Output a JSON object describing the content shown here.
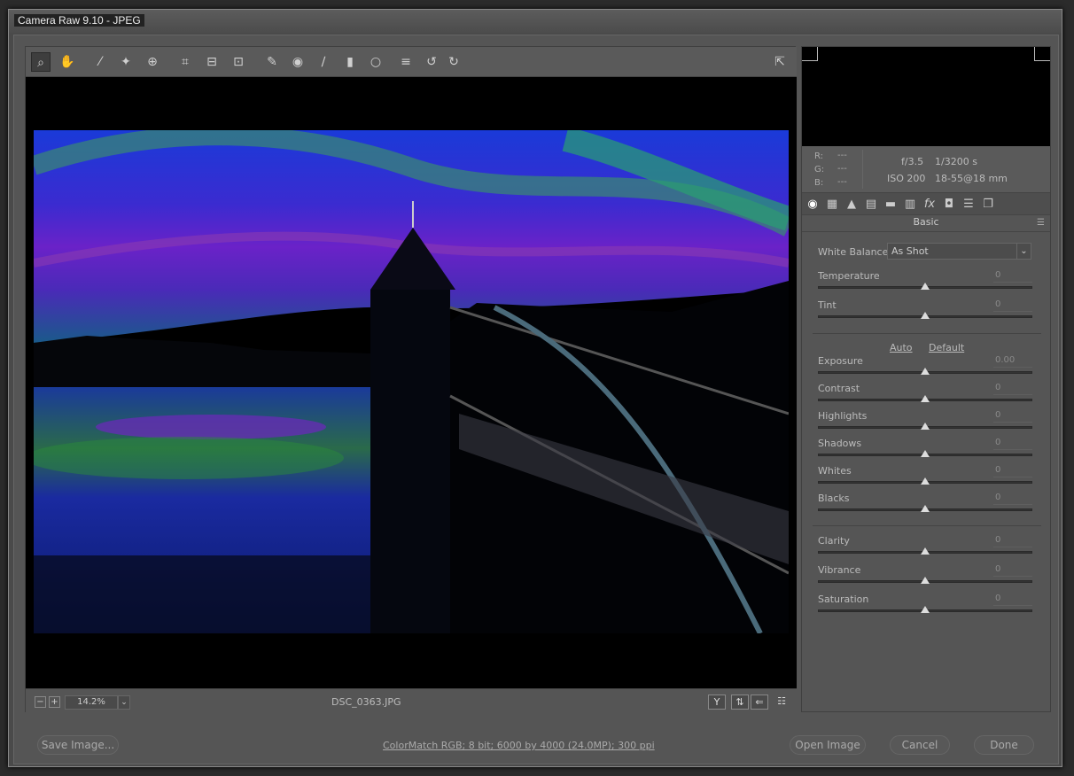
{
  "window": {
    "title": "Camera Raw 9.10  -  JPEG"
  },
  "toolbar": {
    "tools": [
      {
        "name": "zoom-tool",
        "icon": "magnifier-icon",
        "glyph": "⌕"
      },
      {
        "name": "hand-tool",
        "icon": "hand-icon",
        "glyph": "✋"
      },
      {
        "name": "white-balance-tool",
        "icon": "eyedropper-icon",
        "glyph": "⁄"
      },
      {
        "name": "color-sampler-tool",
        "icon": "color-sampler-icon",
        "glyph": "✦"
      },
      {
        "name": "targeted-adjustment-tool",
        "icon": "target-icon",
        "glyph": "⊕"
      },
      {
        "name": "crop-tool",
        "icon": "crop-icon",
        "glyph": "⌗"
      },
      {
        "name": "straighten-tool",
        "icon": "straighten-icon",
        "glyph": "⊟"
      },
      {
        "name": "transform-tool",
        "icon": "transform-icon",
        "glyph": "⊡"
      },
      {
        "name": "spot-removal-tool",
        "icon": "spot-removal-icon",
        "glyph": "✎"
      },
      {
        "name": "red-eye-tool",
        "icon": "red-eye-icon",
        "glyph": "◉"
      },
      {
        "name": "adjustment-brush-tool",
        "icon": "brush-icon",
        "glyph": "∕"
      },
      {
        "name": "graduated-filter-tool",
        "icon": "graduated-filter-icon",
        "glyph": "▮"
      },
      {
        "name": "radial-filter-tool",
        "icon": "radial-filter-icon",
        "glyph": "○"
      },
      {
        "name": "preferences-tool",
        "icon": "list-icon",
        "glyph": "≡"
      },
      {
        "name": "rotate-left-tool",
        "icon": "rotate-left-icon",
        "glyph": "↺"
      },
      {
        "name": "rotate-right-tool",
        "icon": "rotate-right-icon",
        "glyph": "↻"
      }
    ],
    "fullscreen_glyph": "⇱"
  },
  "status": {
    "zoom_out": "−",
    "zoom_in": "+",
    "zoom": "14.2%",
    "zoom_drop": "⌄",
    "filename": "DSC_0363.JPG",
    "view_y": "Y",
    "view_swap": "⇅",
    "view_arrow": "⇐",
    "view_settings": "☷"
  },
  "info": {
    "r_label": "R:",
    "g_label": "G:",
    "b_label": "B:",
    "r_val": "---",
    "g_val": "---",
    "b_val": "---",
    "aperture": "f/3.5",
    "shutter": "1/3200 s",
    "iso": "ISO 200",
    "lens": "18-55@18 mm"
  },
  "panel": {
    "tabs": [
      {
        "name": "tab-basic",
        "icon": "basic-icon",
        "glyph": "◉"
      },
      {
        "name": "tab-tone-curve",
        "icon": "tone-curve-icon",
        "glyph": "▦"
      },
      {
        "name": "tab-detail",
        "icon": "detail-icon",
        "glyph": "▲"
      },
      {
        "name": "tab-hsl",
        "icon": "hsl-icon",
        "glyph": "▤"
      },
      {
        "name": "tab-split-toning",
        "icon": "split-toning-icon",
        "glyph": "▬"
      },
      {
        "name": "tab-lens",
        "icon": "lens-icon",
        "glyph": "▥"
      },
      {
        "name": "tab-effects",
        "icon": "fx-icon",
        "glyph": "fx"
      },
      {
        "name": "tab-camera-calibration",
        "icon": "camera-icon",
        "glyph": "◘"
      },
      {
        "name": "tab-presets",
        "icon": "presets-icon",
        "glyph": "☰"
      },
      {
        "name": "tab-snapshots",
        "icon": "snapshots-icon",
        "glyph": "❐"
      }
    ],
    "title": "Basic",
    "menu_glyph": "☰",
    "wb_label": "White Balance:",
    "wb_value": "As Shot",
    "wb_arrow": "⌄",
    "auto": "Auto",
    "default": "Default",
    "sliders": {
      "temperature": {
        "label": "Temperature",
        "value": "0",
        "pos": 0.5
      },
      "tint": {
        "label": "Tint",
        "value": "0",
        "pos": 0.5
      },
      "exposure": {
        "label": "Exposure",
        "value": "0.00",
        "pos": 0.5
      },
      "contrast": {
        "label": "Contrast",
        "value": "0",
        "pos": 0.5
      },
      "highlights": {
        "label": "Highlights",
        "value": "0",
        "pos": 0.5
      },
      "shadows": {
        "label": "Shadows",
        "value": "0",
        "pos": 0.5
      },
      "whites": {
        "label": "Whites",
        "value": "0",
        "pos": 0.5
      },
      "blacks": {
        "label": "Blacks",
        "value": "0",
        "pos": 0.5
      },
      "clarity": {
        "label": "Clarity",
        "value": "0",
        "pos": 0.5
      },
      "vibrance": {
        "label": "Vibrance",
        "value": "0",
        "pos": 0.5
      },
      "saturation": {
        "label": "Saturation",
        "value": "0",
        "pos": 0.5
      }
    }
  },
  "footer": {
    "save": "Save Image...",
    "workflow": "ColorMatch RGB; 8 bit; 6000 by 4000 (24.0MP); 300 ppi",
    "open": "Open Image",
    "cancel": "Cancel",
    "done": "Done"
  }
}
